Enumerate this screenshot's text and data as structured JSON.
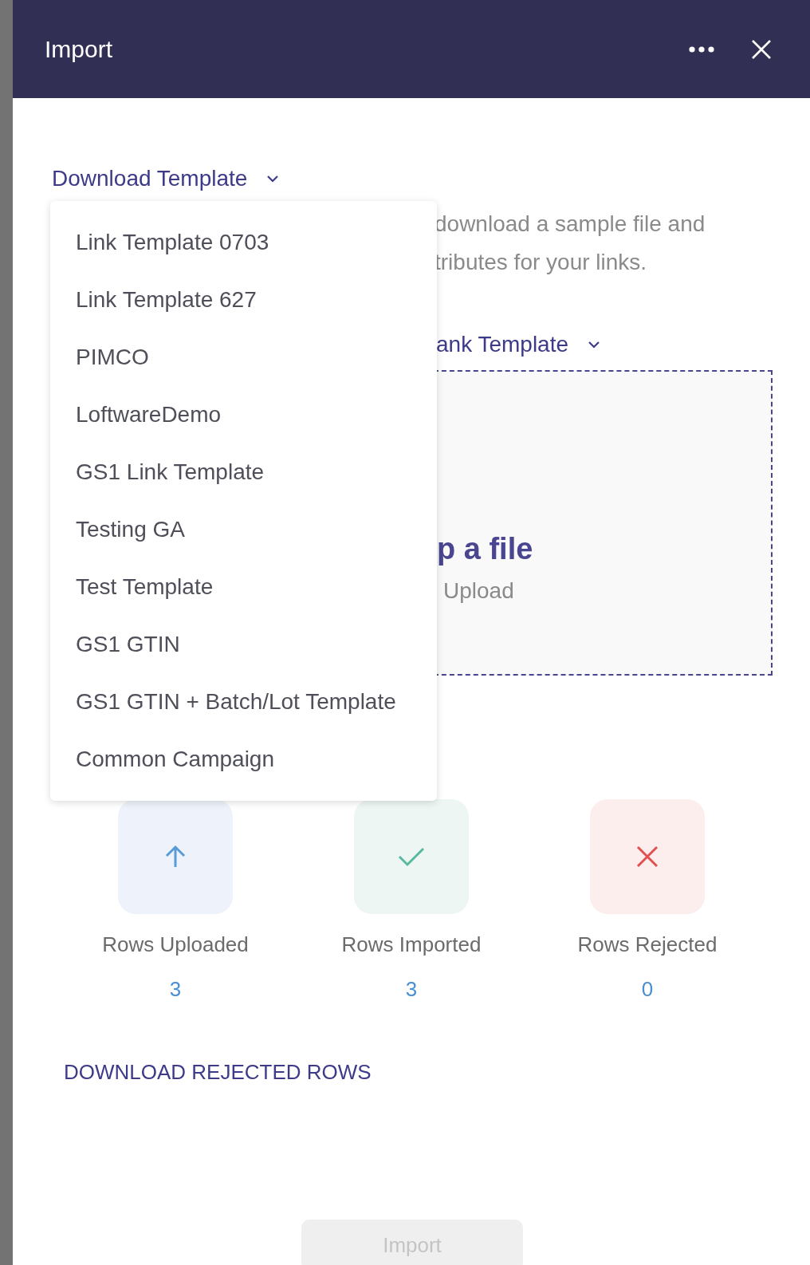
{
  "window": {
    "title": "Import"
  },
  "download_template": {
    "label": "Download Template",
    "expanded": true
  },
  "template_menu": {
    "items": [
      {
        "label": "Link Template 0703",
        "selected": false
      },
      {
        "label": "Link Template 627",
        "selected": false
      },
      {
        "label": "PIMCO",
        "selected": false
      },
      {
        "label": "LoftwareDemo",
        "selected": false
      },
      {
        "label": "GS1 Link Template",
        "selected": false
      },
      {
        "label": "Testing GA",
        "selected": false
      },
      {
        "label": "Test Template",
        "selected": false
      },
      {
        "label": "GS1 GTIN",
        "selected": false
      },
      {
        "label": "GS1 GTIN + Batch/Lot Template",
        "selected": false
      },
      {
        "label": "Common Campaign",
        "selected": false
      }
    ]
  },
  "description": [
    "download a sample file and",
    "tributes for your links."
  ],
  "template_select": {
    "label": "ank Template"
  },
  "dropzone": {
    "title": "p a file",
    "subtitle": "Upload"
  },
  "stats": [
    {
      "kind": "uploaded",
      "label": "Rows Uploaded",
      "value": "3"
    },
    {
      "kind": "imported",
      "label": "Rows Imported",
      "value": "3"
    },
    {
      "kind": "rejected",
      "label": "Rows Rejected",
      "value": "0"
    }
  ],
  "download_rejected": "DOWNLOAD REJECTED ROWS",
  "import_button": {
    "label": "Import",
    "disabled": true
  }
}
